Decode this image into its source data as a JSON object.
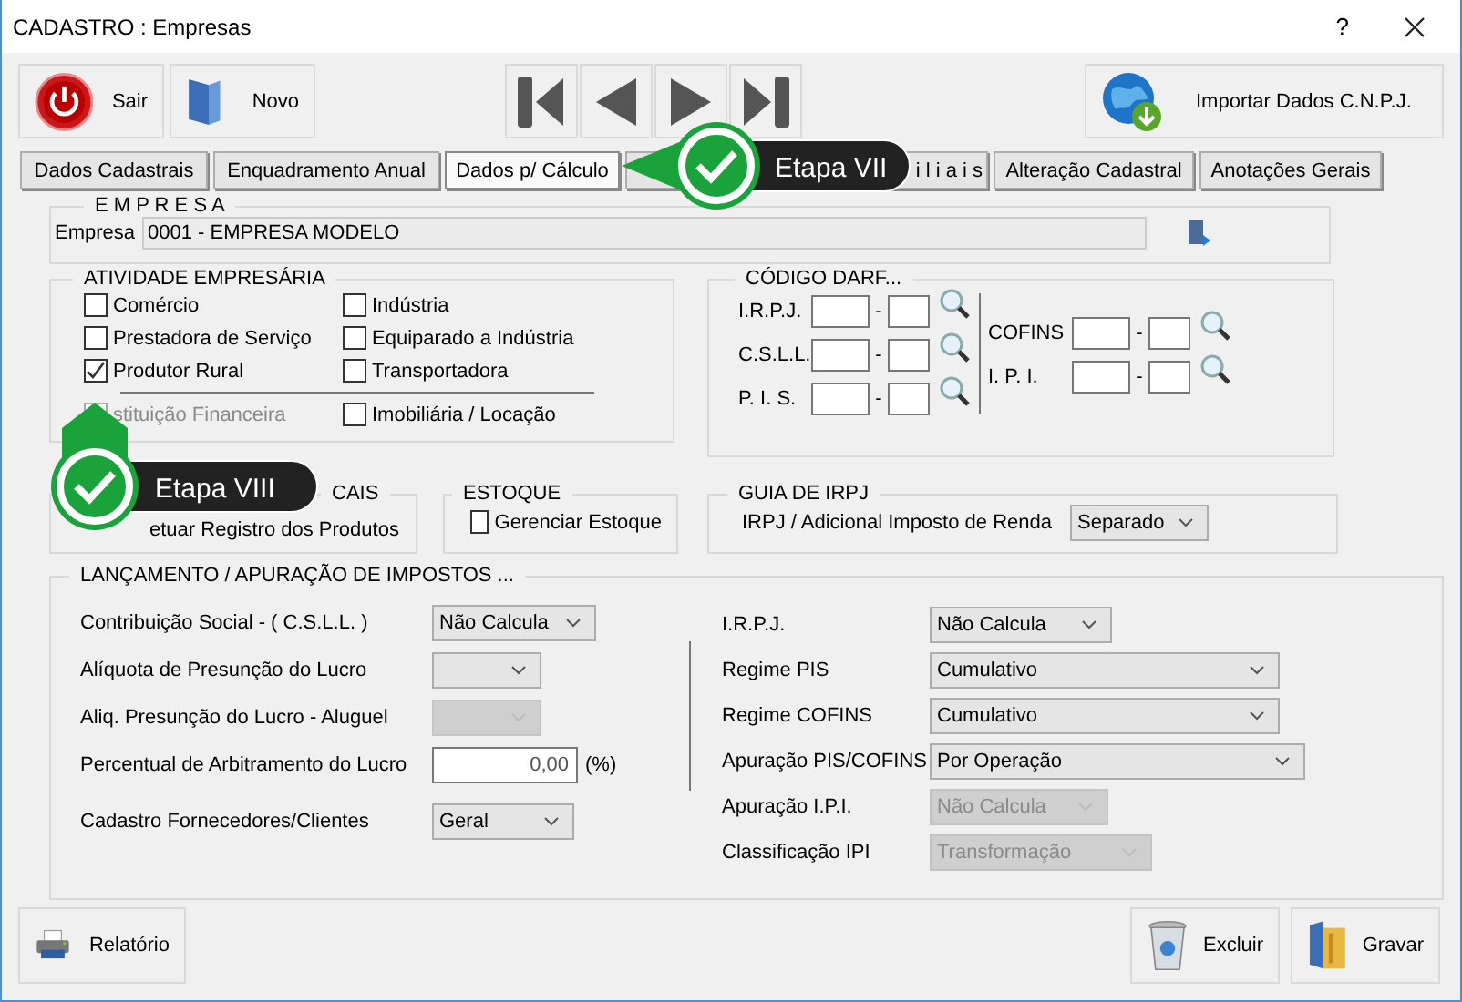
{
  "window": {
    "title": "CADASTRO : Empresas",
    "help": "?"
  },
  "toolbar": {
    "left": [
      {
        "label": "Sair"
      },
      {
        "label": "Novo"
      }
    ],
    "import": {
      "label": "Importar Dados C.N.P.J."
    }
  },
  "tabs": [
    {
      "label": "Dados Cadastrais",
      "selected": false
    },
    {
      "label": "Enquadramento Anual",
      "selected": false
    },
    {
      "label": "Dados p/ Cálculo",
      "selected": true
    },
    {
      "label": "i l i a i s",
      "selected": false
    },
    {
      "label": "Alteração Cadastral",
      "selected": false
    },
    {
      "label": "Anotações Gerais",
      "selected": false
    }
  ],
  "empresa": {
    "title": "E M P R E S A",
    "label": "Empresa",
    "value": "0001 - EMPRESA MODELO"
  },
  "atividade": {
    "title": "ATIVIDADE EMPRESÁRIA",
    "items": [
      {
        "label": "Comércio",
        "checked": false,
        "disabled": false
      },
      {
        "label": "Indústria",
        "checked": false,
        "disabled": false
      },
      {
        "label": "Prestadora de Serviço",
        "checked": false,
        "disabled": false
      },
      {
        "label": "Equiparado a Indústria",
        "checked": false,
        "disabled": false
      },
      {
        "label": "Produtor Rural",
        "checked": true,
        "disabled": false
      },
      {
        "label": "Transportadora",
        "checked": false,
        "disabled": false
      }
    ],
    "items_below": [
      {
        "label": "stituição Financeira",
        "checked": false,
        "disabled": true
      },
      {
        "label": "Imobiliária / Locação",
        "checked": false,
        "disabled": false
      }
    ]
  },
  "darf": {
    "title": "CÓDIGO DARF...",
    "left": [
      {
        "label": "I.R.P.J."
      },
      {
        "label": "C.S.L.L."
      },
      {
        "label": "P. I. S."
      }
    ],
    "right": [
      {
        "label": "COFINS"
      },
      {
        "label": "I. P. I."
      }
    ],
    "separator": "-"
  },
  "notas": {
    "title": "CAIS",
    "item": "etuar Registro dos Produtos"
  },
  "estoque": {
    "title": "ESTOQUE",
    "item": {
      "label": "Gerenciar Estoque",
      "checked": false
    }
  },
  "guia": {
    "title": "GUIA DE IRPJ",
    "label": "IRPJ / Adicional Imposto de Renda",
    "value": "Separado"
  },
  "lancamento": {
    "title": "LANÇAMENTO / APURAÇÃO DE IMPOSTOS ...",
    "left": [
      {
        "label": "Contribuição Social - ( C.S.L.L. )",
        "kind": "select",
        "value": "Não Calcula",
        "disabled": false
      },
      {
        "label": "Alíquota de Presunção do Lucro",
        "kind": "select",
        "disabled": false
      },
      {
        "label": "Aliq. Presunção do Lucro - Aluguel",
        "kind": "select",
        "disabled": true
      },
      {
        "label": "Percentual de Arbitramento do Lucro",
        "kind": "input",
        "value": "0,00",
        "suffix": "(%)"
      },
      {
        "label": "Cadastro Fornecedores/Clientes",
        "kind": "select",
        "value": "Geral",
        "disabled": false
      }
    ],
    "right": [
      {
        "label": "I.R.P.J.",
        "kind": "select",
        "value": "Não Calcula",
        "disabled": false
      },
      {
        "label": "Regime PIS",
        "kind": "select",
        "value": "Cumulativo",
        "disabled": false
      },
      {
        "label": "Regime COFINS",
        "kind": "select",
        "value": "Cumulativo",
        "disabled": false
      },
      {
        "label": "Apuração PIS/COFINS",
        "kind": "select",
        "value": "Por Operação",
        "disabled": false
      },
      {
        "label": "Apuração I.P.I.",
        "kind": "select",
        "value": "Não Calcula",
        "disabled": true
      },
      {
        "label": "Classificação IPI",
        "kind": "select",
        "value": "Transformação",
        "disabled": true
      }
    ]
  },
  "bottom": {
    "left": [
      {
        "label": "Relatório"
      }
    ],
    "right": [
      {
        "label": "Excluir"
      },
      {
        "label": "Gravar"
      }
    ]
  },
  "callouts": [
    {
      "label": "Etapa VII"
    },
    {
      "label": "Etapa VIII"
    }
  ]
}
